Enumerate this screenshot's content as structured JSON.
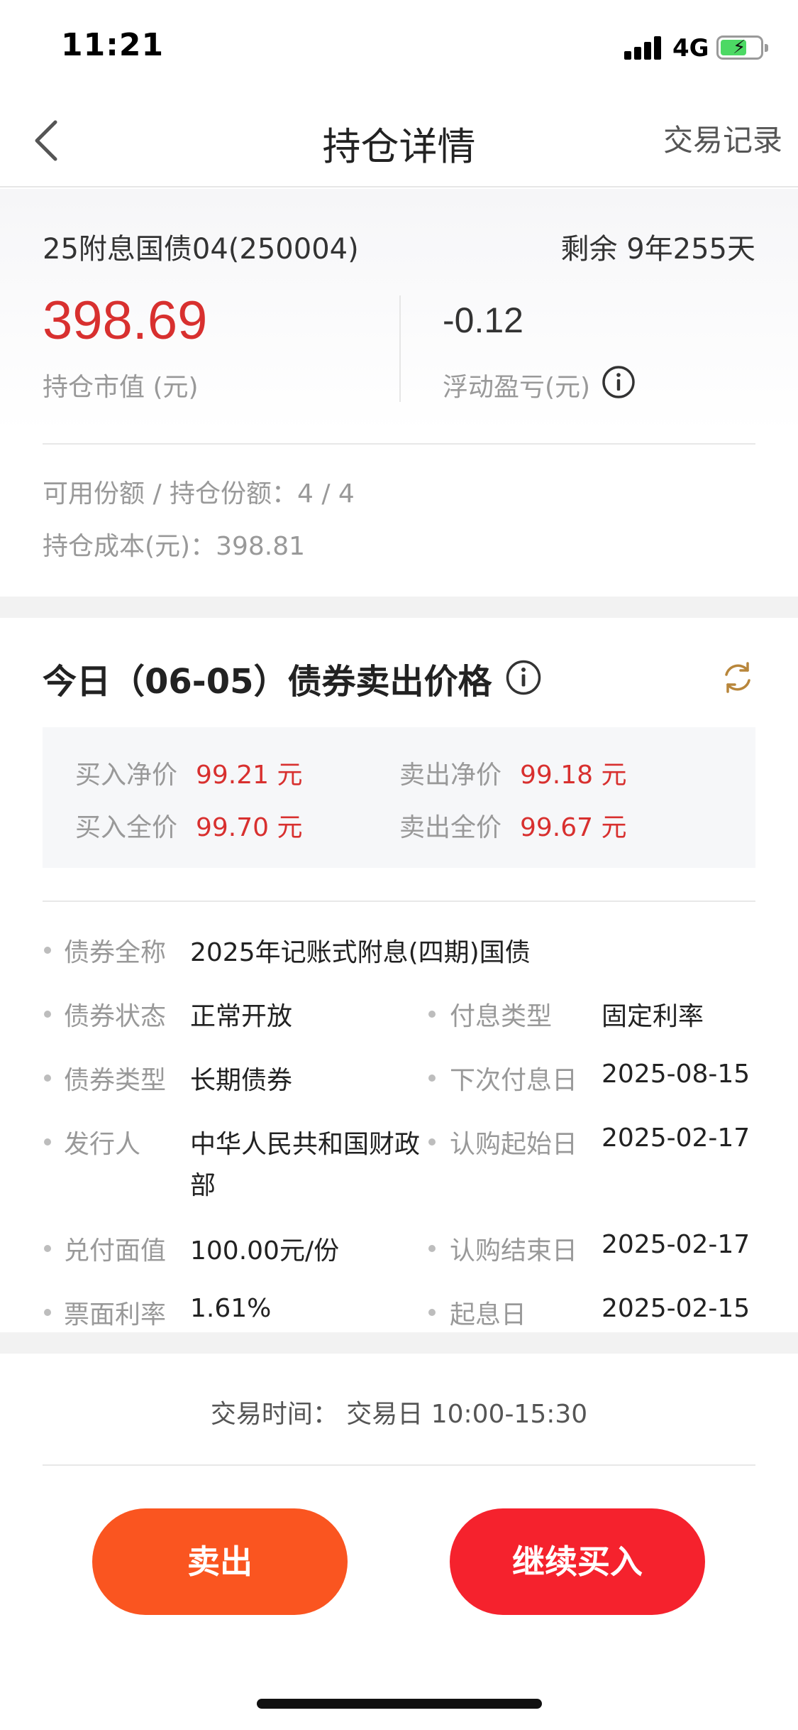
{
  "status_bar": {
    "time": "11:21",
    "network": "4G"
  },
  "nav": {
    "title": "持仓详情",
    "action": "交易记录"
  },
  "summary": {
    "bond_name": "25附息国债04(250004)",
    "remaining": "剩余  9年255天",
    "market_value": "398.69",
    "market_value_label": "持仓市值 (元)",
    "float_pl": "-0.12",
    "float_pl_label": "浮动盈亏(元)",
    "shares": "可用份额 / 持仓份额：4 / 4",
    "cost": "持仓成本(元)：398.81"
  },
  "price": {
    "title": "今日（06-05）债券卖出价格",
    "buy_net_label": "买入净价",
    "buy_net_value": "99.21 元",
    "sell_net_label": "卖出净价",
    "sell_net_value": "99.18 元",
    "buy_full_label": "买入全价",
    "buy_full_value": "99.70 元",
    "sell_full_label": "卖出全价",
    "sell_full_value": "99.67 元"
  },
  "details": {
    "full_name_label": "债券全称",
    "full_name": "2025年记账式附息(四期)国债",
    "status_label": "债券状态",
    "status": "正常开放",
    "interest_type_label": "付息类型",
    "interest_type": "固定利率",
    "bond_type_label": "债券类型",
    "bond_type": "长期债券",
    "next_pay_label": "下次付息日",
    "next_pay": "2025-08-15",
    "issuer_label": "发行人",
    "issuer_line1": "中华人民共和国财政",
    "issuer_line2": "部",
    "sub_start_label": "认购起始日",
    "sub_start": "2025-02-17",
    "face_label": "兑付面值",
    "face": "100.00元/份",
    "sub_end_label": "认购结束日",
    "sub_end": "2025-02-17",
    "coupon_label": "票面利率",
    "coupon": "1.61%",
    "value_date_label": "起息日",
    "value_date": "2025-02-15"
  },
  "trade_time": "交易时间：  交易日 10:00-15:30",
  "buttons": {
    "sell": "卖出",
    "buy_more": "继续买入"
  },
  "colors": {
    "red": "#d8302f",
    "sell_button": "#fa5520",
    "buy_button": "#f5222d"
  },
  "icons": [
    "back-icon",
    "info-icon",
    "refresh-icon",
    "signal-icon",
    "battery-icon"
  ]
}
